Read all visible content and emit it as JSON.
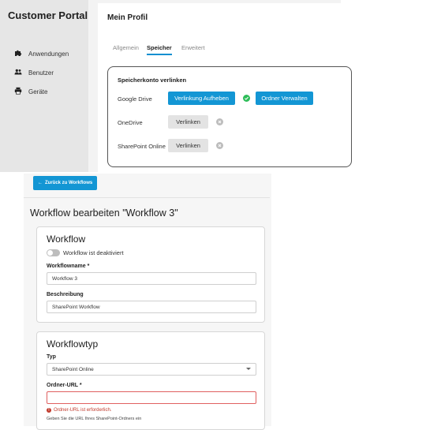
{
  "portal": {
    "brand": "Customer Portal",
    "sidebar": {
      "items": [
        {
          "label": "Anwendungen",
          "icon": "puzzle-icon"
        },
        {
          "label": "Benutzer",
          "icon": "users-icon"
        },
        {
          "label": "Geräte",
          "icon": "printer-icon"
        }
      ]
    },
    "profile": {
      "title": "Mein Profil",
      "tabs": [
        {
          "label": "Allgemein",
          "active": false
        },
        {
          "label": "Speicher",
          "active": true
        },
        {
          "label": "Erweitert",
          "active": false
        }
      ],
      "storage": {
        "heading": "Speicherkonto verlinken",
        "services": [
          {
            "name": "Google Drive",
            "linked": true,
            "unlink_label": "Verlinkung Aufheben",
            "manage_label": "Ordner Verwalten"
          },
          {
            "name": "OneDrive",
            "linked": false,
            "link_label": "Verlinken"
          },
          {
            "name": "SharePoint Online",
            "linked": false,
            "link_label": "Verlinken"
          }
        ]
      }
    }
  },
  "workflow_editor": {
    "back_label": "Zurück zu Workflows",
    "page_title": "Workflow bearbeiten \"Workflow 3\"",
    "workflow_section": {
      "title": "Workflow",
      "toggle_label": "Workflow ist deaktiviert",
      "toggle_on": false,
      "name_label": "Workflowname *",
      "name_value": "Workflow 3",
      "desc_label": "Beschreibung",
      "desc_value": "SharePoint Workflow"
    },
    "type_section": {
      "title": "Workflowtyp",
      "type_label": "Typ",
      "type_value": "SharePoint Online",
      "url_label": "Ordner-URL *",
      "url_value": "",
      "error": "Ordner-URL ist erforderlich.",
      "help": "Geben Sie die URL Ihres SharePoint-Ordners ein"
    }
  },
  "colors": {
    "accent": "#1396d4",
    "success": "#2ebd59",
    "error": "#c0392b",
    "inactive": "#bdbdbd"
  }
}
